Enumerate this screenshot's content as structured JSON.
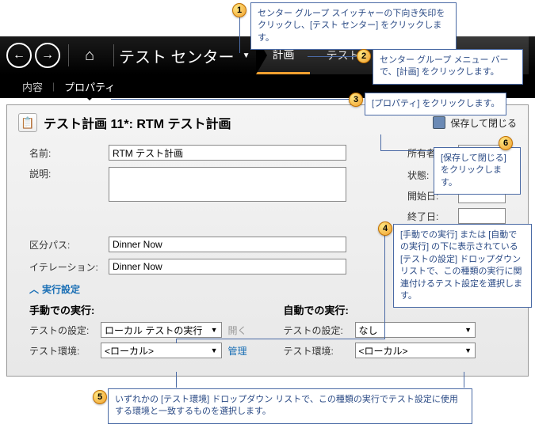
{
  "header": {
    "center_title": "テスト センター",
    "tabs": {
      "plan": "計画",
      "test": "テスト"
    }
  },
  "subtabs": {
    "content": "内容",
    "property": "プロパティ"
  },
  "panel": {
    "title": "テスト計画 11*: RTM テスト計画",
    "save_close": "保存して閉じる"
  },
  "form": {
    "name_label": "名前:",
    "name_value": "RTM テスト計画",
    "desc_label": "説明:",
    "owner_label": "所有者:",
    "state_label": "状態:",
    "start_label": "開始日:",
    "end_label": "終了日:",
    "area_label": "区分パス:",
    "area_value": "Dinner Now",
    "iter_label": "イテレーション:",
    "iter_value": "Dinner Now"
  },
  "run": {
    "section": "実行設定",
    "manual_title": "手動での実行:",
    "auto_title": "自動での実行:",
    "settings_label": "テストの設定:",
    "env_label": "テスト環境:",
    "manual_settings": "ローカル テストの実行",
    "auto_settings": "なし",
    "local": "<ローカル>",
    "open": "開く",
    "manage": "管理"
  },
  "callouts": {
    "c1": "センター グループ スイッチャーの下向き矢印をクリックし、[テスト センター] をクリックします。",
    "c2": "センター グループ メニュー バーで、[計画] をクリックします。",
    "c3": "[プロパティ] をクリックします。",
    "c4": "[手動での実行] または [自動での実行] の下に表示されている [テストの設定] ドロップダウン リストで、この種類の実行に関連付けるテスト設定を選択します。",
    "c5": "いずれかの [テスト環境] ドロップダウン リストで、この種類の実行でテスト設定に使用する環境と一致するものを選択します。",
    "c6": "[保存して閉じる] をクリックします。"
  }
}
